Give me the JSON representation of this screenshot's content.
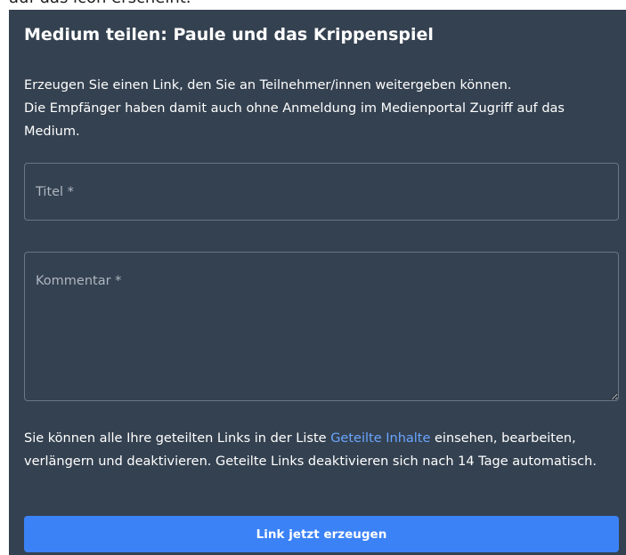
{
  "background": {
    "partial_text": "auf das icon erscheint."
  },
  "dialog": {
    "title": "Medium teilen: Paule und das Krippenspiel",
    "close_icon": "close-icon",
    "intro": {
      "line1": "Erzeugen Sie einen Link, den Sie an Teilnehmer/innen weitergeben können.",
      "line2": "Die Empfänger haben damit auch ohne Anmeldung im Medienportal Zugriff auf das Medium."
    },
    "title_field": {
      "placeholder": "Titel *",
      "value": ""
    },
    "comment_field": {
      "placeholder": "Kommentar *",
      "value": ""
    },
    "info": {
      "before_link": "Sie können alle Ihre geteilten Links in der Liste ",
      "link_text": "Geteilte Inhalte",
      "after_link": " einsehen, bearbeiten, verlängern und deaktivieren. Geteilte Links deaktivieren sich nach 14 Tage automatisch."
    },
    "submit_label": "Link jetzt erzeugen"
  },
  "colors": {
    "dialog_background": "#344150",
    "field_border": "#6a7785",
    "link": "#6aa5ff",
    "primary_button": "#3b82f6",
    "text": "#ffffff"
  }
}
